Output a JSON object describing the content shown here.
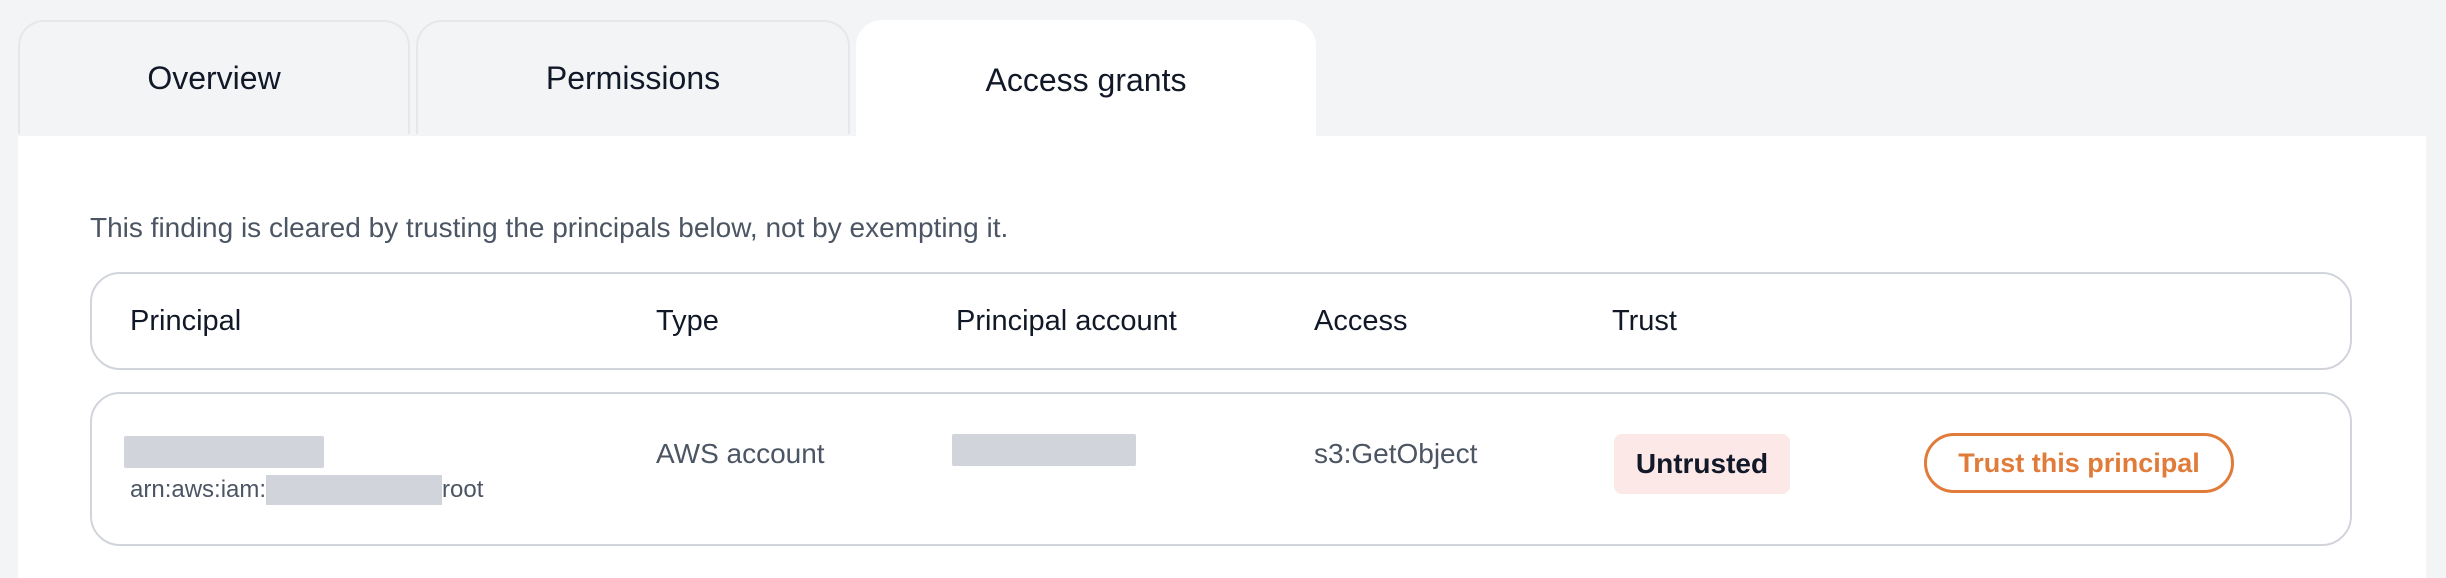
{
  "tabs": [
    {
      "label": "Overview",
      "active": false
    },
    {
      "label": "Permissions",
      "active": false
    },
    {
      "label": "Access grants",
      "active": true
    }
  ],
  "note": "This finding is cleared by trusting the principals below, not by exempting it.",
  "table": {
    "headers": [
      "Principal",
      "Type",
      "Principal account",
      "Access",
      "Trust"
    ],
    "rows": [
      {
        "principal_arn_prefix": "arn:aws:iam:",
        "principal_arn_suffix": "root",
        "type": "AWS account",
        "access": "s3:GetObject",
        "trust_status": "Untrusted",
        "action_label": "Trust this principal"
      }
    ]
  },
  "colors": {
    "accent": "#e07b39",
    "untrusted_bg": "#fde8e8",
    "redaction": "#d1d5db"
  }
}
